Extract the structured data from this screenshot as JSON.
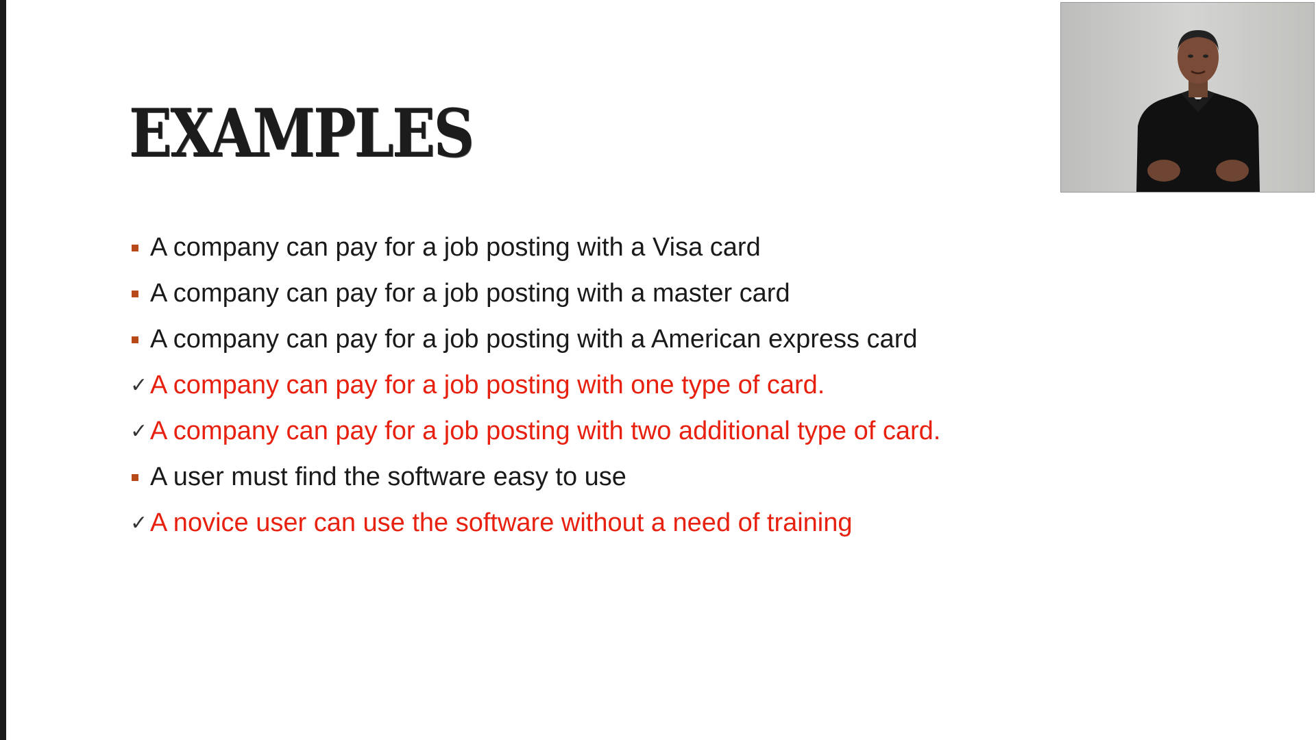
{
  "slide": {
    "title": "EXAMPLES",
    "bullets": [
      {
        "marker": "square",
        "text": "A company can pay for a job posting with a Visa card",
        "color": "#1a1a1a"
      },
      {
        "marker": "square",
        "text": "A company can pay for a job posting with a master card",
        "color": "#1a1a1a"
      },
      {
        "marker": "square",
        "text": "A company can pay for a job posting with a American express card",
        "color": "#1a1a1a"
      },
      {
        "marker": "check",
        "text": "A company can pay for a job posting with one type of card.",
        "color": "#e8200f"
      },
      {
        "marker": "check",
        "text": "A company can pay for a job posting with two additional type of card.",
        "color": "#e8200f"
      },
      {
        "marker": "square",
        "text": "A user must find the software easy to use",
        "color": "#1a1a1a"
      },
      {
        "marker": "check",
        "text": "A novice user can use the software without a need of training",
        "color": "#e8200f"
      }
    ]
  },
  "colors": {
    "square_bullet": "#b84a1a",
    "check_mark": "#333333",
    "highlight_text": "#e8200f",
    "body_text": "#1a1a1a"
  },
  "webcam": {
    "icon": "presenter-video"
  }
}
